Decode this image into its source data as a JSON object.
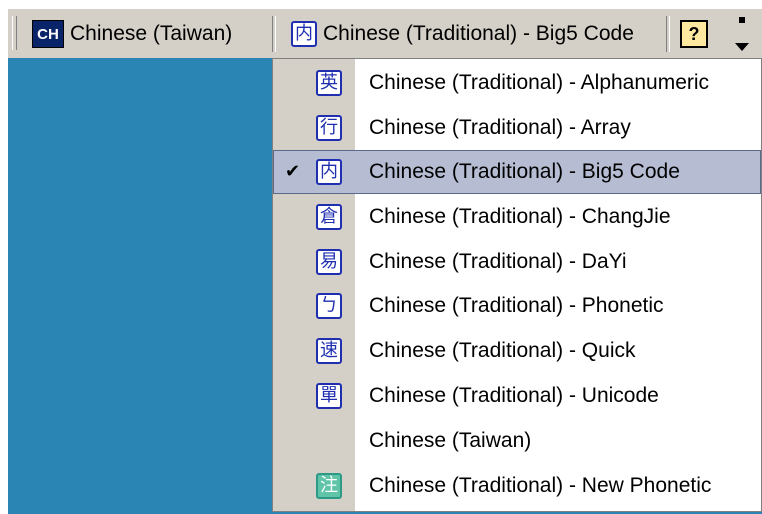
{
  "langbar": {
    "language_icon": "CH",
    "language_label": "Chinese (Taiwan)",
    "ime_icon": "内",
    "ime_label": "Chinese (Traditional) - Big5 Code",
    "help_icon": "?"
  },
  "menu": {
    "items": [
      {
        "label": "Chinese (Traditional) - Alphanumeric",
        "icon": "英",
        "checked": false
      },
      {
        "label": "Chinese (Traditional) - Array",
        "icon": "行",
        "checked": false
      },
      {
        "label": "Chinese (Traditional) - Big5 Code",
        "icon": "内",
        "checked": true
      },
      {
        "label": "Chinese (Traditional) - ChangJie",
        "icon": "倉",
        "checked": false
      },
      {
        "label": "Chinese (Traditional) - DaYi",
        "icon": "易",
        "checked": false
      },
      {
        "label": "Chinese (Traditional) - Phonetic",
        "icon": "ㄅ",
        "checked": false
      },
      {
        "label": "Chinese (Traditional) - Quick",
        "icon": "速",
        "checked": false
      },
      {
        "label": "Chinese (Traditional) - Unicode",
        "icon": "單",
        "checked": false
      },
      {
        "label": "Chinese (Taiwan)",
        "icon": "",
        "checked": false
      },
      {
        "label": "Chinese (Traditional) - New Phonetic",
        "icon": "注",
        "checked": false
      }
    ],
    "check_mark": "✔"
  },
  "colors": {
    "desktop": "#2a84b4",
    "toolbar": "#d4d0c8",
    "selection": "#b6bdd2",
    "icon_blue": "#1f2fb0"
  }
}
